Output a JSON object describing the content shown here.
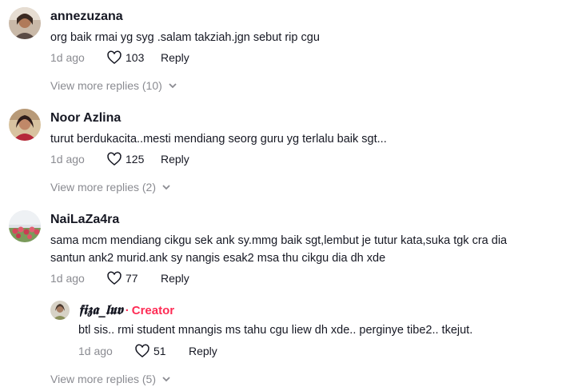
{
  "comments": [
    {
      "username": "annezuzana",
      "text": "org baik rmai yg syg .salam takziah.jgn sebut rip cgu",
      "time": "1d ago",
      "likes": "103",
      "reply_label": "Reply",
      "more_replies": "View more replies (10)"
    },
    {
      "username": "Noor Azlina",
      "text": "turut berdukacita..mesti mendiang seorg guru yg terlalu baik sgt...",
      "time": "1d ago",
      "likes": "125",
      "reply_label": "Reply",
      "more_replies": "View more replies (2)"
    },
    {
      "username": "NaiLaZa4ra",
      "text_line1": "sama mcm mendiang cikgu sek ank sy.mmg baik sgt,lembut je tutur kata,suka tgk cra dia",
      "text_line2": "santun ank2 murid.ank sy nangis esak2 msa thu cikgu dia dh xde",
      "time": "1d ago",
      "likes": "77",
      "reply_label": "Reply",
      "reply": {
        "username": "𝖋𝖎𝖟𝖆_𝖑𝖚𝖛",
        "dot": "·",
        "creator_label": "Creator",
        "text": "btl sis.. rmi student mnangis ms tahu cgu liew dh xde.. perginye tibe2.. tkejut.",
        "time": "1d ago",
        "likes": "51",
        "reply_label": "Reply"
      },
      "more_replies": "View more replies (5)"
    }
  ],
  "colors": {
    "accent": "#fe2c55",
    "muted": "#8a8b91",
    "text": "#161823"
  }
}
